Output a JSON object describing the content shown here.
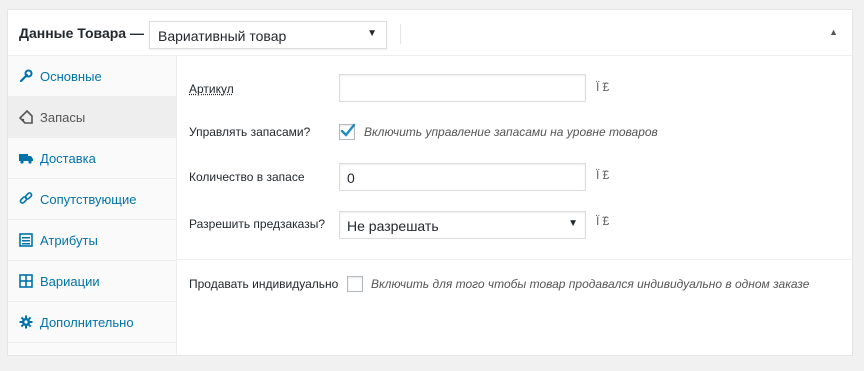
{
  "header": {
    "title": "Данные Товара —",
    "product_type": "Вариативный товар",
    "collapse_icon": "triangle-up-icon"
  },
  "tabs": [
    {
      "label": "Основные",
      "icon": "wrench-icon",
      "active": false
    },
    {
      "label": "Запасы",
      "icon": "tag-icon",
      "active": true
    },
    {
      "label": "Доставка",
      "icon": "truck-icon",
      "active": false
    },
    {
      "label": "Сопутствующие",
      "icon": "link-icon",
      "active": false
    },
    {
      "label": "Атрибуты",
      "icon": "list-icon",
      "active": false
    },
    {
      "label": "Вариации",
      "icon": "grid-icon",
      "active": false
    },
    {
      "label": "Дополнительно",
      "icon": "gear-icon",
      "active": false
    }
  ],
  "fields": {
    "sku": {
      "label": "Артикул",
      "value": "",
      "help": "Ï ̃£"
    },
    "manage_stock": {
      "label": "Управлять запасами?",
      "checked": true,
      "description": "Включить управление запасами на уровне товаров"
    },
    "stock_qty": {
      "label": "Количество в запасе",
      "value": "0",
      "help": "Ï ̃£"
    },
    "backorders": {
      "label": "Разрешить предзаказы?",
      "value": "Не разрешать",
      "help": "Ï ̃£"
    },
    "sold_individually": {
      "label": "Продавать индивидуально",
      "checked": false,
      "description": "Включить для того чтобы товар продавался индивидуально в одном заказе"
    }
  },
  "colors": {
    "link": "#0073aa",
    "check": "#1e8cbe"
  }
}
